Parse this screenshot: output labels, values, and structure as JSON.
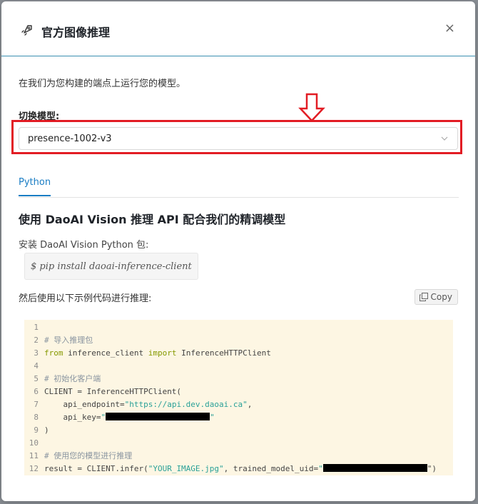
{
  "dialog": {
    "title": "官方图像推理",
    "close_label": "×"
  },
  "description": "在我们为您构建的端点上运行您的模型。",
  "switch_model": {
    "label": "切换模型:",
    "selected": "presence-1002-v3"
  },
  "tabs": [
    {
      "label": "Python",
      "active": true
    }
  ],
  "section_title": "使用 DaoAI Vision 推理 API 配合我们的精调模型",
  "install": {
    "label": "安装 DaoAI Vision Python 包:",
    "command": "$ pip install daoai-inference-client"
  },
  "usage": {
    "label": "然后使用以下示例代码进行推理:",
    "copy_label": "Copy"
  },
  "code": {
    "line_numbers": [
      "1",
      "2",
      "3",
      "4",
      "5",
      "6",
      "7",
      "8",
      "9",
      "10",
      "11",
      "12"
    ],
    "comment_import": "# 导入推理包",
    "kw_from": "from",
    "module": " inference_client ",
    "kw_import": "import",
    "class_name": " InferenceHTTPClient",
    "comment_init": "# 初始化客户端",
    "client_ctor": "CLIENT = InferenceHTTPClient(",
    "api_endpoint_key": "    api_endpoint=",
    "api_endpoint_value": "\"https://api.dev.daoai.ca\"",
    "api_endpoint_tail": ",",
    "api_key_key": "    api_key=",
    "api_key_open": "\"",
    "api_key_close": "\"",
    "close_paren": ")",
    "comment_infer": "# 使用您的模型进行推理",
    "infer_head": "result = CLIENT.infer(",
    "infer_image": "\"YOUR_IMAGE.jpg\"",
    "infer_mid": ", trained_model_uid=",
    "infer_uid_open": "\"",
    "infer_tail": "\")"
  },
  "colors": {
    "highlight_border": "#e21c24",
    "tab_active": "#1a7dc4",
    "code_background": "#fdf6e3"
  },
  "icons": {
    "header": "rocket-icon",
    "annotation": "down-arrow-icon",
    "select": "chevron-down-icon",
    "copy": "copy-icon"
  }
}
